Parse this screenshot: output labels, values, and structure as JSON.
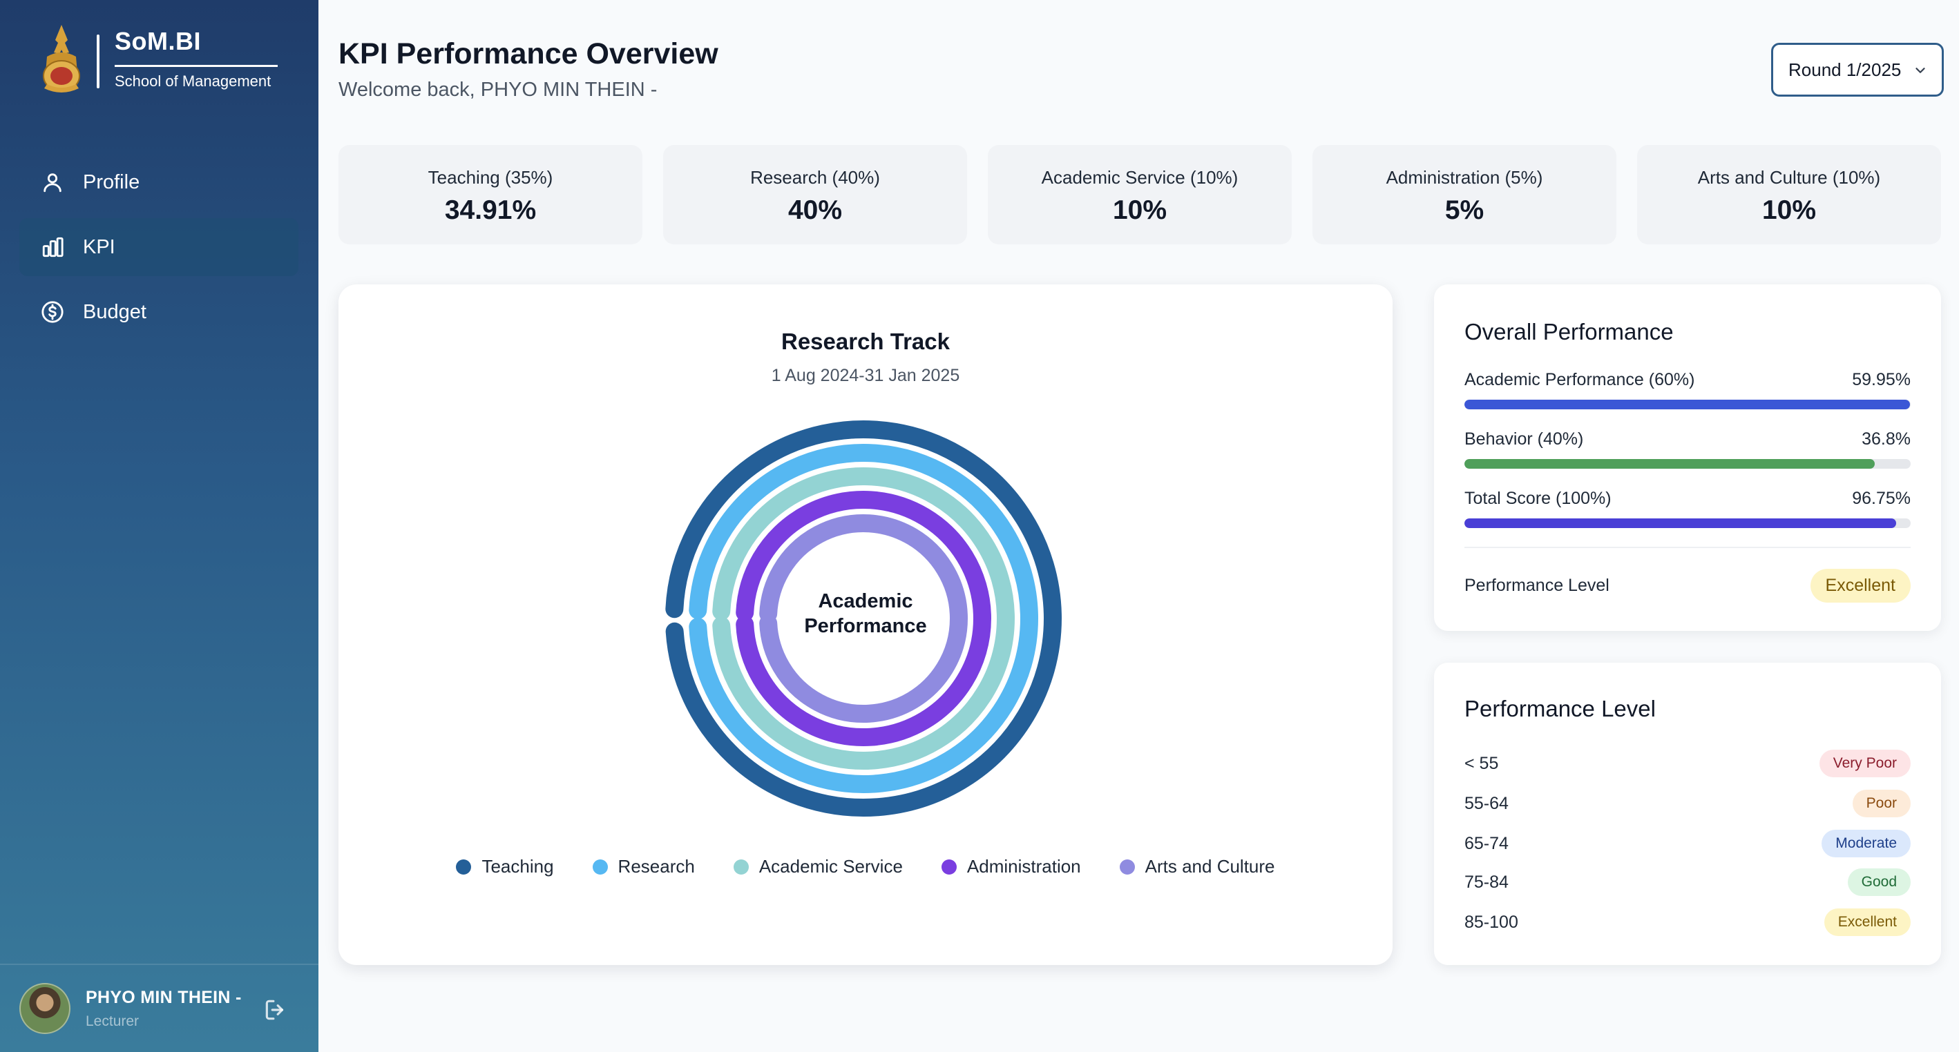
{
  "brand": {
    "name": "SoM.BI",
    "subtitle": "School of Management"
  },
  "nav": [
    {
      "label": "Profile",
      "icon": "user-icon",
      "active": false
    },
    {
      "label": "KPI",
      "icon": "bar-chart-icon",
      "active": true
    },
    {
      "label": "Budget",
      "icon": "dollar-circle-icon",
      "active": false
    }
  ],
  "user": {
    "name": "PHYO MIN THEIN -",
    "role": "Lecturer"
  },
  "header": {
    "title": "KPI Performance Overview",
    "subtitle": "Welcome back, PHYO MIN THEIN -",
    "round_value": "Round 1/2025"
  },
  "kpi_cards": [
    {
      "label": "Teaching (35%)",
      "value": "34.91%"
    },
    {
      "label": "Research (40%)",
      "value": "40%"
    },
    {
      "label": "Academic Service (10%)",
      "value": "10%"
    },
    {
      "label": "Administration (5%)",
      "value": "5%"
    },
    {
      "label": "Arts and Culture (10%)",
      "value": "10%"
    }
  ],
  "chart": {
    "title": "Research Track",
    "subtitle": "1 Aug 2024-31 Jan 2025",
    "center_line1": "Academic",
    "center_line2": "Performance"
  },
  "chart_data": {
    "type": "radial_bar",
    "title": "Research Track",
    "subtitle": "1 Aug 2024-31 Jan 2025",
    "center_label": "Academic Performance",
    "unit": "% of category max",
    "legend_position": "bottom",
    "series": [
      {
        "name": "Teaching",
        "value": 99.7,
        "color": "#245f98"
      },
      {
        "name": "Research",
        "value": 100,
        "color": "#56b8f2"
      },
      {
        "name": "Academic Service",
        "value": 100,
        "color": "#93d3d3"
      },
      {
        "name": "Administration",
        "value": 100,
        "color": "#7a3ee0"
      },
      {
        "name": "Arts and Culture",
        "value": 100,
        "color": "#8f8be0"
      }
    ]
  },
  "overall": {
    "title": "Overall Performance",
    "metrics": [
      {
        "label": "Academic Performance (60%)",
        "value": "59.95%",
        "percent": 99.9,
        "color": "#3b57d6"
      },
      {
        "label": "Behavior (40%)",
        "value": "36.8%",
        "percent": 92,
        "color": "#4f9f5a"
      },
      {
        "label": "Total Score (100%)",
        "value": "96.75%",
        "percent": 96.75,
        "color": "#4a3fd6"
      }
    ],
    "level_label": "Performance Level",
    "level_value": "Excellent"
  },
  "levels": {
    "title": "Performance Level",
    "rows": [
      {
        "range": "< 55",
        "label": "Very Poor",
        "bg": "#fde4e6",
        "fg": "#8b1d2c"
      },
      {
        "range": "55-64",
        "label": "Poor",
        "bg": "#fdebd9",
        "fg": "#8a4a0f"
      },
      {
        "range": "65-74",
        "label": "Moderate",
        "bg": "#dbe8fc",
        "fg": "#1e3f8a"
      },
      {
        "range": "75-84",
        "label": "Good",
        "bg": "#ddf5e3",
        "fg": "#1f6b37"
      },
      {
        "range": "85-100",
        "label": "Excellent",
        "bg": "#fdf4c4",
        "fg": "#7a5a06"
      }
    ]
  }
}
